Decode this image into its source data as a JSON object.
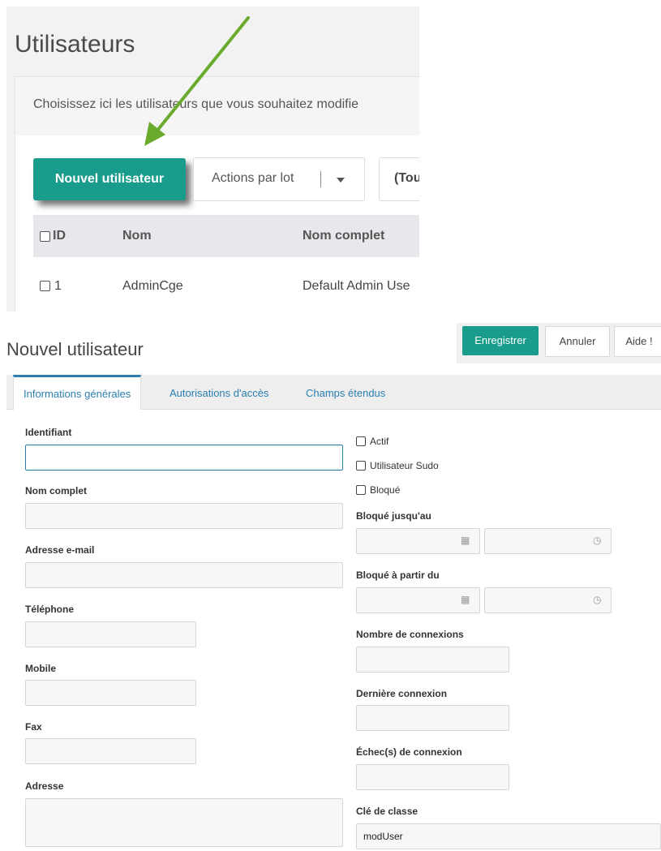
{
  "list_page": {
    "title": "Utilisateurs",
    "description": "Choisissez ici les utilisateurs que vous souhaitez modifie",
    "new_user_button": "Nouvel utilisateur",
    "bulk_actions": "Actions par lot",
    "filter_value": "(Tou",
    "columns": [
      "ID",
      "Nom",
      "Nom complet"
    ],
    "rows": [
      {
        "id": "1",
        "nom": "AdminCge",
        "nom_complet": "Default Admin Use"
      }
    ],
    "annotation_arrow_color": "#6aab2e"
  },
  "form_page": {
    "title": "Nouvel utilisateur",
    "toolbar": {
      "save": "Enregistrer",
      "cancel": "Annuler",
      "help": "Aide !",
      "save_color": "#1a9c8c"
    },
    "tabs": [
      "Informations générales",
      "Autorisations d'accès",
      "Champs étendus"
    ],
    "active_tab": "Informations générales",
    "left_fields": {
      "username": {
        "label": "Identifiant",
        "value": ""
      },
      "fullname": {
        "label": "Nom complet",
        "value": ""
      },
      "email": {
        "label": "Adresse e-mail",
        "value": ""
      },
      "phone": {
        "label": "Téléphone",
        "value": ""
      },
      "mobile": {
        "label": "Mobile",
        "value": ""
      },
      "fax": {
        "label": "Fax",
        "value": ""
      },
      "address": {
        "label": "Adresse",
        "value": ""
      }
    },
    "right_fields": {
      "active": "Actif",
      "sudo": "Utilisateur Sudo",
      "blocked": "Bloqué",
      "blocked_until": "Bloqué jusqu'au",
      "blocked_after": "Bloqué à partir du",
      "logincount": "Nombre de connexions",
      "lastlogin": "Dernière connexion",
      "failed": "Échec(s) de connexion",
      "class_key": {
        "label": "Clé de classe",
        "value": "modUser"
      }
    },
    "icons": {
      "date": "calendar-icon",
      "time": "clock-icon"
    }
  }
}
